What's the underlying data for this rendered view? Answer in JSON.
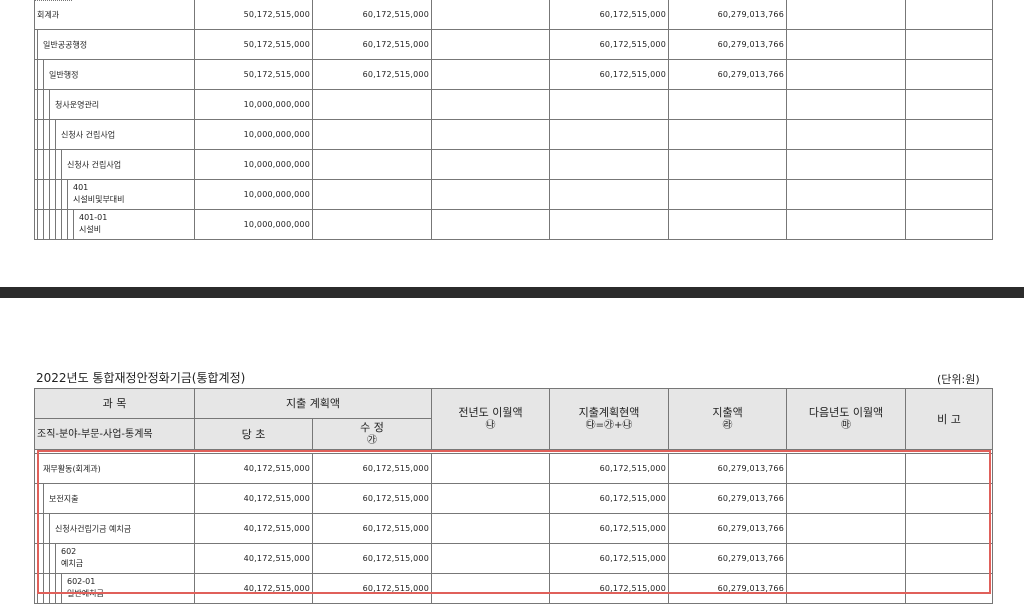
{
  "top_rows": [
    {
      "name": "회계과",
      "level": 0,
      "two_line": false,
      "name2": "",
      "dangcho": "50,172,515,000",
      "sujeong": "60,172,515,000",
      "jeonyeondo": "",
      "hyeonaek": "60,172,515,000",
      "jichul": "60,279,013,766",
      "daeum": "",
      "bigo": ""
    },
    {
      "name": "일반공공행정",
      "level": 1,
      "two_line": false,
      "name2": "",
      "dangcho": "50,172,515,000",
      "sujeong": "60,172,515,000",
      "jeonyeondo": "",
      "hyeonaek": "60,172,515,000",
      "jichul": "60,279,013,766",
      "daeum": "",
      "bigo": ""
    },
    {
      "name": "일반행정",
      "level": 2,
      "two_line": false,
      "name2": "",
      "dangcho": "50,172,515,000",
      "sujeong": "60,172,515,000",
      "jeonyeondo": "",
      "hyeonaek": "60,172,515,000",
      "jichul": "60,279,013,766",
      "daeum": "",
      "bigo": ""
    },
    {
      "name": "청사운영관리",
      "level": 3,
      "two_line": false,
      "name2": "",
      "dangcho": "10,000,000,000",
      "sujeong": "",
      "jeonyeondo": "",
      "hyeonaek": "",
      "jichul": "",
      "daeum": "",
      "bigo": ""
    },
    {
      "name": "신청사 건립사업",
      "level": 4,
      "two_line": false,
      "name2": "",
      "dangcho": "10,000,000,000",
      "sujeong": "",
      "jeonyeondo": "",
      "hyeonaek": "",
      "jichul": "",
      "daeum": "",
      "bigo": ""
    },
    {
      "name": "신청사 건립사업",
      "level": 5,
      "two_line": false,
      "name2": "",
      "dangcho": "10,000,000,000",
      "sujeong": "",
      "jeonyeondo": "",
      "hyeonaek": "",
      "jichul": "",
      "daeum": "",
      "bigo": ""
    },
    {
      "name": "401",
      "level": 6,
      "two_line": true,
      "name2": "시설비및부대비",
      "dangcho": "10,000,000,000",
      "sujeong": "",
      "jeonyeondo": "",
      "hyeonaek": "",
      "jichul": "",
      "daeum": "",
      "bigo": ""
    },
    {
      "name": "401-01",
      "level": 7,
      "two_line": true,
      "name2": "시설비",
      "dangcho": "10,000,000,000",
      "sujeong": "",
      "jeonyeondo": "",
      "hyeonaek": "",
      "jichul": "",
      "daeum": "",
      "bigo": ""
    }
  ],
  "section": {
    "title": "2022년도 통합재정안정화기금(통합계정)",
    "unit": "(단위:원)"
  },
  "header": {
    "gwamok": "과        목",
    "gwamok_sub": "조직-분야-부문-사업-통계목",
    "jichul_plan": "지출 계획액",
    "dangcho": "당  초",
    "sujeong": "수  정",
    "sujeong_mark": "㉮",
    "jeonyeondo": "전년도 이월액",
    "jeonyeondo_mark": "㉯",
    "hyeonaek": "지출계획현액",
    "hyeonaek_mark": "㉰=㉮+㉯",
    "jichul": "지출액",
    "jichul_mark": "㉱",
    "daeum": "다음년도 이월액",
    "daeum_mark": "㉲",
    "bigo": "비  고"
  },
  "bottom_rows": [
    {
      "name": "재무활동(회계과)",
      "level": 1,
      "two_line": false,
      "name2": "",
      "dangcho": "40,172,515,000",
      "sujeong": "60,172,515,000",
      "jeonyeondo": "",
      "hyeonaek": "60,172,515,000",
      "jichul": "60,279,013,766",
      "daeum": "",
      "bigo": ""
    },
    {
      "name": "보전지출",
      "level": 2,
      "two_line": false,
      "name2": "",
      "dangcho": "40,172,515,000",
      "sujeong": "60,172,515,000",
      "jeonyeondo": "",
      "hyeonaek": "60,172,515,000",
      "jichul": "60,279,013,766",
      "daeum": "",
      "bigo": ""
    },
    {
      "name": "신청사건립기금 예치금",
      "level": 3,
      "two_line": false,
      "name2": "",
      "dangcho": "40,172,515,000",
      "sujeong": "60,172,515,000",
      "jeonyeondo": "",
      "hyeonaek": "60,172,515,000",
      "jichul": "60,279,013,766",
      "daeum": "",
      "bigo": ""
    },
    {
      "name": "602",
      "level": 4,
      "two_line": true,
      "name2": "예치금",
      "dangcho": "40,172,515,000",
      "sujeong": "60,172,515,000",
      "jeonyeondo": "",
      "hyeonaek": "60,172,515,000",
      "jichul": "60,279,013,766",
      "daeum": "",
      "bigo": ""
    },
    {
      "name": "602-01",
      "level": 5,
      "two_line": true,
      "name2": "일반예치금",
      "dangcho": "40,172,515,000",
      "sujeong": "60,172,515,000",
      "jeonyeondo": "",
      "hyeonaek": "60,172,515,000",
      "jichul": "60,279,013,766",
      "daeum": "",
      "bigo": ""
    }
  ]
}
